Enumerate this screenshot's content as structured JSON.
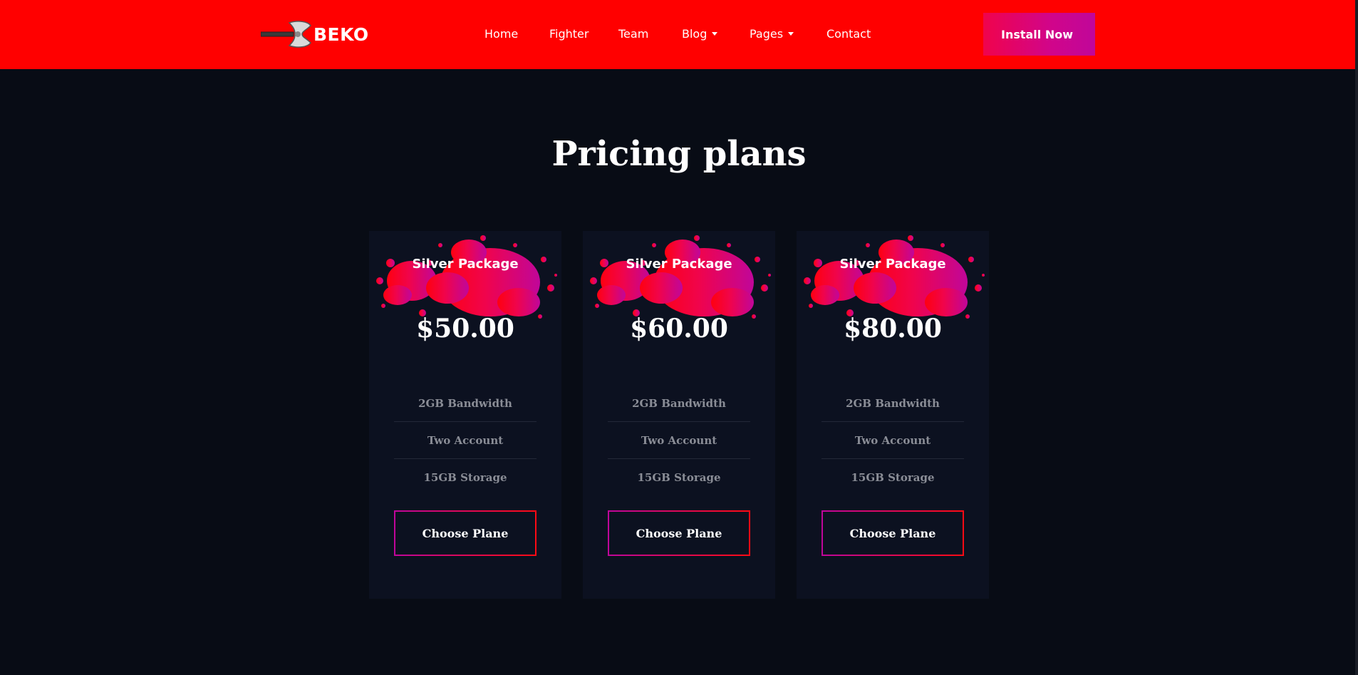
{
  "header": {
    "brand": "BEKO",
    "nav": [
      {
        "label": "Home",
        "has_dropdown": false
      },
      {
        "label": "Fighter",
        "has_dropdown": false
      },
      {
        "label": "Team",
        "has_dropdown": false
      },
      {
        "label": "Blog",
        "has_dropdown": true
      },
      {
        "label": "Pages",
        "has_dropdown": true
      },
      {
        "label": "Contact",
        "has_dropdown": false
      }
    ],
    "install_label": "Install Now"
  },
  "pricing": {
    "title": "Pricing plans",
    "plans": [
      {
        "name": "Silver Package",
        "price": "$50.00",
        "features": [
          "2GB Bandwidth",
          "Two Account",
          "15GB Storage"
        ],
        "button": "Choose Plane"
      },
      {
        "name": "Silver Package",
        "price": "$60.00",
        "features": [
          "2GB Bandwidth",
          "Two Account",
          "15GB Storage"
        ],
        "button": "Choose Plane"
      },
      {
        "name": "Silver Package",
        "price": "$80.00",
        "features": [
          "2GB Bandwidth",
          "Two Account",
          "15GB Storage"
        ],
        "button": "Choose Plane"
      }
    ]
  },
  "colors": {
    "header_bg": "#ff0000",
    "page_bg": "#080c15",
    "card_bg": "#0c1120",
    "accent_pink": "#c0069a",
    "accent_red": "#ff0a14"
  },
  "icons": {
    "logo": "battle-axe-icon",
    "dropdown": "caret-down-icon",
    "splash": "paint-splash-icon"
  }
}
